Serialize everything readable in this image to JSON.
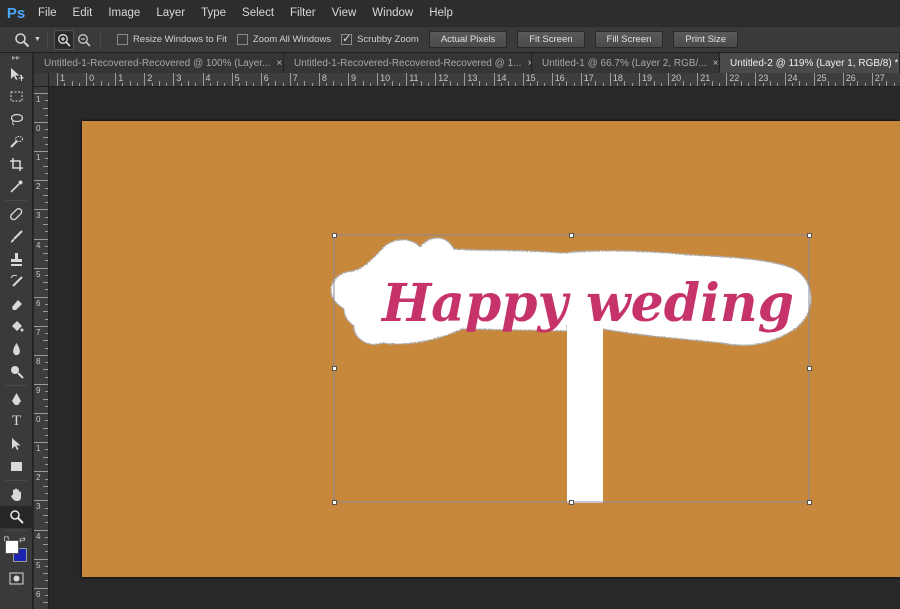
{
  "app": {
    "logo": "Ps"
  },
  "menu": [
    "File",
    "Edit",
    "Image",
    "Layer",
    "Type",
    "Select",
    "Filter",
    "View",
    "Window",
    "Help"
  ],
  "options": {
    "resize_windows": {
      "label": "Resize Windows to Fit",
      "checked": false
    },
    "zoom_all": {
      "label": "Zoom All Windows",
      "checked": false
    },
    "scrubby": {
      "label": "Scrubby Zoom",
      "checked": true
    },
    "buttons": [
      "Actual Pixels",
      "Fit Screen",
      "Fill Screen",
      "Print Size"
    ]
  },
  "tabs": [
    {
      "title": "Untitled-1-Recovered-Recovered @ 100% (Layer...",
      "active": false
    },
    {
      "title": "Untitled-1-Recovered-Recovered-Recovered @ 1...",
      "active": false
    },
    {
      "title": "Untitled-1 @ 66.7% (Layer 2, RGB/...",
      "active": false
    },
    {
      "title": "Untitled-2 @ 119% (Layer 1, RGB/8) *",
      "active": true
    }
  ],
  "ruler_h_labels": [
    "1",
    "0",
    "1",
    "2",
    "3",
    "4",
    "5",
    "6",
    "7",
    "8",
    "9",
    "10",
    "11",
    "12",
    "13",
    "14",
    "15",
    "16",
    "17",
    "18",
    "19",
    "20",
    "21",
    "22",
    "23",
    "24",
    "25",
    "26",
    "27"
  ],
  "ruler_v_labels": [
    "1",
    "0",
    "1",
    "2",
    "3",
    "4",
    "5",
    "6",
    "7",
    "8",
    "9",
    "0",
    "1",
    "2",
    "3",
    "4",
    "5",
    "6"
  ],
  "artwork": {
    "text": "Happy weding"
  },
  "colors": {
    "canvas": "#c8883c",
    "text": "#c6336a",
    "foreground": "#ffffff",
    "background": "#1c24b0"
  }
}
